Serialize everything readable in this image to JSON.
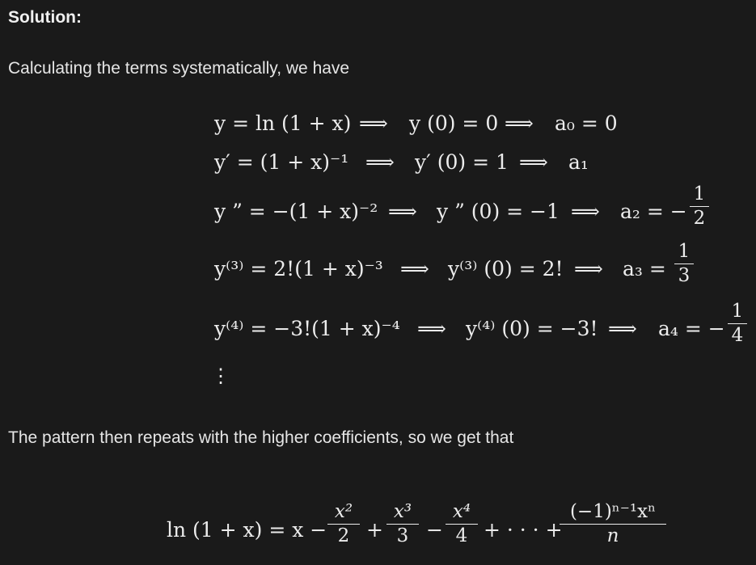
{
  "heading": "Solution:",
  "intro": "Calculating the terms systematically, we have",
  "rows": [
    {
      "lhs": "y = ln (1 + x)",
      "mid": "y (0) = 0",
      "rhs": "a₀ = 0"
    },
    {
      "lhs": "y′ = (1 + x)⁻¹",
      "mid": "y′ (0) = 1",
      "rhs": "a₁"
    },
    {
      "lhs": "y ” = −(1 + x)⁻²",
      "mid": "y ” (0) = −1",
      "rhs": "a₂ = −",
      "frac_num": "1",
      "frac_den": "2"
    },
    {
      "lhs": "y⁽³⁾ = 2!(1 + x)⁻³",
      "mid": "y⁽³⁾ (0) = 2!",
      "rhs": "a₃ =",
      "frac_num": "1",
      "frac_den": "3"
    },
    {
      "lhs": "y⁽⁴⁾ = −3!(1 + x)⁻⁴",
      "mid": "y⁽⁴⁾ (0) = −3!",
      "rhs": "a₄ = −",
      "frac_num": "1",
      "frac_den": "4"
    }
  ],
  "implies": "⟹",
  "vdots": "⋮",
  "pattern_text": "The pattern then repeats with the higher coefficients, so we get that",
  "series": {
    "lhs": "ln (1 + x) = x −",
    "t2_num": "x²",
    "t2_den": "2",
    "plus1": "+",
    "t3_num": "x³",
    "t3_den": "3",
    "minus1": "−",
    "t4_num": "x⁴",
    "t4_den": "4",
    "tail": "+ · · · +",
    "tn_num": "(−1)ⁿ⁻¹xⁿ",
    "tn_den": "n"
  }
}
